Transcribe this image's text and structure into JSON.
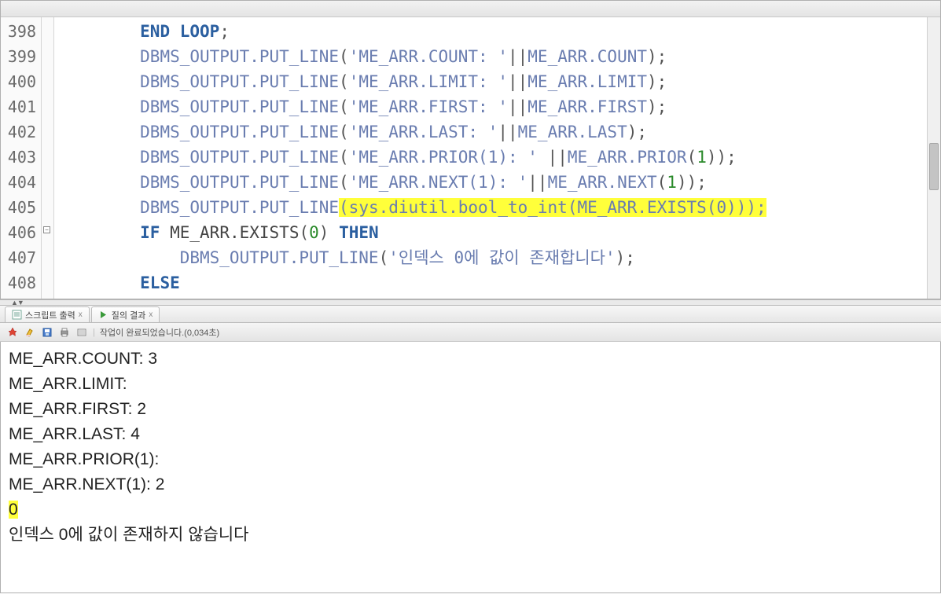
{
  "editor": {
    "header_left": "",
    "lines": [
      {
        "num": "398",
        "fold": "",
        "tokens": [
          {
            "t": "        ",
            "c": ""
          },
          {
            "t": "END LOOP",
            "c": "kw"
          },
          {
            "t": ";",
            "c": "pl"
          }
        ]
      },
      {
        "num": "399",
        "fold": "",
        "tokens": [
          {
            "t": "        ",
            "c": ""
          },
          {
            "t": "DBMS_OUTPUT.PUT_LINE",
            "c": "fn"
          },
          {
            "t": "(",
            "c": "pl"
          },
          {
            "t": "'ME_ARR.COUNT: '",
            "c": "str"
          },
          {
            "t": "||",
            "c": "pl"
          },
          {
            "t": "ME_ARR.COUNT",
            "c": "fn"
          },
          {
            "t": ");",
            "c": "pl"
          }
        ]
      },
      {
        "num": "400",
        "fold": "",
        "tokens": [
          {
            "t": "        ",
            "c": ""
          },
          {
            "t": "DBMS_OUTPUT.PUT_LINE",
            "c": "fn"
          },
          {
            "t": "(",
            "c": "pl"
          },
          {
            "t": "'ME_ARR.LIMIT: '",
            "c": "str"
          },
          {
            "t": "||",
            "c": "pl"
          },
          {
            "t": "ME_ARR.LIMIT",
            "c": "fn"
          },
          {
            "t": ");",
            "c": "pl"
          }
        ]
      },
      {
        "num": "401",
        "fold": "",
        "tokens": [
          {
            "t": "        ",
            "c": ""
          },
          {
            "t": "DBMS_OUTPUT.PUT_LINE",
            "c": "fn"
          },
          {
            "t": "(",
            "c": "pl"
          },
          {
            "t": "'ME_ARR.FIRST: '",
            "c": "str"
          },
          {
            "t": "||",
            "c": "pl"
          },
          {
            "t": "ME_ARR.FIRST",
            "c": "fn"
          },
          {
            "t": ");",
            "c": "pl"
          }
        ]
      },
      {
        "num": "402",
        "fold": "",
        "tokens": [
          {
            "t": "        ",
            "c": ""
          },
          {
            "t": "DBMS_OUTPUT.PUT_LINE",
            "c": "fn"
          },
          {
            "t": "(",
            "c": "pl"
          },
          {
            "t": "'ME_ARR.LAST: '",
            "c": "str"
          },
          {
            "t": "||",
            "c": "pl"
          },
          {
            "t": "ME_ARR.LAST",
            "c": "fn"
          },
          {
            "t": ");",
            "c": "pl"
          }
        ]
      },
      {
        "num": "403",
        "fold": "",
        "tokens": [
          {
            "t": "        ",
            "c": ""
          },
          {
            "t": "DBMS_OUTPUT.PUT_LINE",
            "c": "fn"
          },
          {
            "t": "(",
            "c": "pl"
          },
          {
            "t": "'ME_ARR.PRIOR(1): '",
            "c": "str"
          },
          {
            "t": " ||",
            "c": "pl"
          },
          {
            "t": "ME_ARR.PRIOR",
            "c": "fn"
          },
          {
            "t": "(",
            "c": "pl"
          },
          {
            "t": "1",
            "c": "num"
          },
          {
            "t": "));",
            "c": "pl"
          }
        ]
      },
      {
        "num": "404",
        "fold": "",
        "tokens": [
          {
            "t": "        ",
            "c": ""
          },
          {
            "t": "DBMS_OUTPUT.PUT_LINE",
            "c": "fn"
          },
          {
            "t": "(",
            "c": "pl"
          },
          {
            "t": "'ME_ARR.NEXT(1): '",
            "c": "str"
          },
          {
            "t": "||",
            "c": "pl"
          },
          {
            "t": "ME_ARR.NEXT",
            "c": "fn"
          },
          {
            "t": "(",
            "c": "pl"
          },
          {
            "t": "1",
            "c": "num"
          },
          {
            "t": "));",
            "c": "pl"
          }
        ]
      },
      {
        "num": "405",
        "fold": "",
        "tokens": [
          {
            "t": "        ",
            "c": ""
          },
          {
            "t": "DBMS_OUTPUT.PUT_LINE",
            "c": "fn"
          },
          {
            "t": "(sys.diutil.bool_to_int(ME_ARR.EXISTS(0)));",
            "c": "fn",
            "hl": true
          }
        ]
      },
      {
        "num": "406",
        "fold": "−",
        "tokens": [
          {
            "t": "        ",
            "c": ""
          },
          {
            "t": "IF",
            "c": "kw"
          },
          {
            "t": " ",
            "c": ""
          },
          {
            "t": "ME_ARR.EXISTS",
            "c": "ident"
          },
          {
            "t": "(",
            "c": "pl"
          },
          {
            "t": "0",
            "c": "num"
          },
          {
            "t": ") ",
            "c": "pl"
          },
          {
            "t": "THEN",
            "c": "kw"
          }
        ]
      },
      {
        "num": "407",
        "fold": "",
        "tokens": [
          {
            "t": "            ",
            "c": ""
          },
          {
            "t": "DBMS_OUTPUT.PUT_LINE",
            "c": "fn"
          },
          {
            "t": "(",
            "c": "pl"
          },
          {
            "t": "'인덱스 0에 값이 존재합니다'",
            "c": "str"
          },
          {
            "t": ");",
            "c": "pl"
          }
        ]
      },
      {
        "num": "408",
        "fold": "",
        "tokens": [
          {
            "t": "        ",
            "c": ""
          },
          {
            "t": "ELSE",
            "c": "kw"
          }
        ]
      }
    ]
  },
  "tabs": [
    {
      "label": "스크립트 출력",
      "icon": "script"
    },
    {
      "label": "질의 결과",
      "icon": "play"
    }
  ],
  "toolbar_status": "작업이 완료되었습니다.(0,034초)",
  "output": [
    {
      "text": "ME_ARR.COUNT: 3",
      "hl": false
    },
    {
      "text": "ME_ARR.LIMIT:",
      "hl": false
    },
    {
      "text": "ME_ARR.FIRST: 2",
      "hl": false
    },
    {
      "text": "ME_ARR.LAST: 4",
      "hl": false
    },
    {
      "text": "ME_ARR.PRIOR(1):",
      "hl": false
    },
    {
      "text": "ME_ARR.NEXT(1): 2",
      "hl": false
    },
    {
      "text": "0",
      "hl": true
    },
    {
      "text": "인덱스 0에 값이 존재하지 않습니다",
      "hl": false
    }
  ]
}
